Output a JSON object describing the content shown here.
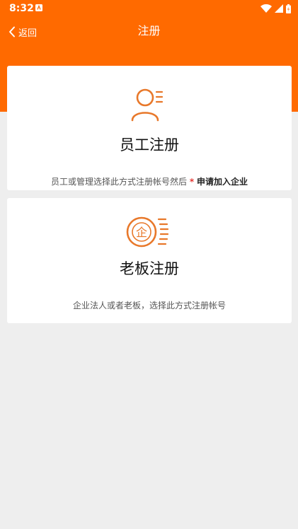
{
  "status_bar": {
    "time": "8:32"
  },
  "nav": {
    "back_label": "返回",
    "title": "注册"
  },
  "cards": {
    "employee": {
      "title": "员工注册",
      "description": "员工或管理选择此方式注册帐号然后",
      "asterisk": "*",
      "link": "申请加入企业"
    },
    "boss": {
      "title": "老板注册",
      "description": "企业法人或者老板，选择此方式注册帐号",
      "icon_text": "企"
    }
  },
  "colors": {
    "accent": "#ff6a00",
    "icon": "#e8782a",
    "background": "#eeeeee"
  },
  "icons": {
    "back": "chevron-left-icon",
    "employee": "user-icon",
    "boss": "enterprise-icon"
  }
}
